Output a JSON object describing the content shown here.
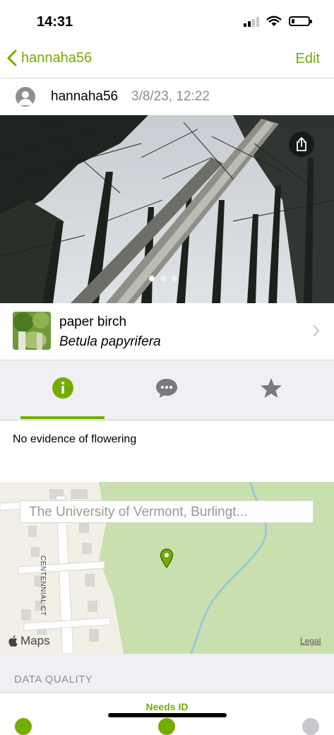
{
  "status_bar": {
    "time": "14:31"
  },
  "nav": {
    "back_label": "hannaha56",
    "edit_label": "Edit"
  },
  "observation": {
    "username": "hannaha56",
    "datetime": "3/8/23, 12:22",
    "photo_count": 3,
    "active_photo": 1
  },
  "taxon": {
    "common_name": "paper birch",
    "scientific_name": "Betula papyrifera"
  },
  "tabs": [
    {
      "name": "info",
      "icon": "info-icon",
      "active": true
    },
    {
      "name": "activity",
      "icon": "chat-bubble-icon",
      "active": false
    },
    {
      "name": "favorites",
      "icon": "star-icon",
      "active": false
    }
  ],
  "annotation_text": "No evidence of flowering",
  "map": {
    "place_placeholder": "The University of Vermont, Burlingt...",
    "street_name": "CENTENNIAL CT",
    "maps_label": "Maps",
    "legal_label": "Legal"
  },
  "data_quality": {
    "header": "DATA QUALITY",
    "status": "Needs ID"
  },
  "colors": {
    "accent": "#74ac00",
    "grey": "#8e8e93",
    "tab_bg": "#efeff4",
    "map_green": "#c9dfae"
  }
}
